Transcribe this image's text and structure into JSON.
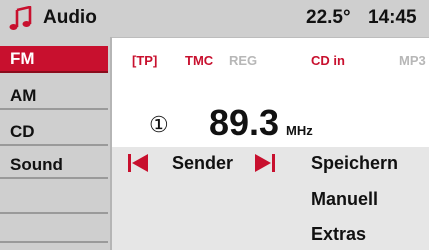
{
  "header": {
    "icon": "music-note-icon",
    "title": "Audio",
    "temperature": "22.5°",
    "time": "14:45"
  },
  "menu": {
    "items": [
      {
        "label": "FM",
        "active": true
      },
      {
        "label": "AM",
        "active": false
      },
      {
        "label": "CD",
        "active": false
      },
      {
        "label": "Sound",
        "active": false
      },
      {
        "label": "",
        "active": false
      },
      {
        "label": "",
        "active": false
      },
      {
        "label": "",
        "active": false
      }
    ]
  },
  "status": {
    "tp": "[TP]",
    "tmc": "TMC",
    "reg": "REG",
    "cd_in": "CD in",
    "mp3": "MP3"
  },
  "tuner": {
    "preset": "①",
    "frequency": "89.3",
    "unit": "MHz"
  },
  "controls": {
    "prev_icon": "skip-back-icon",
    "sender_label": "Sender",
    "next_icon": "skip-forward-icon",
    "speichern_label": "Speichern",
    "manuell_label": "Manuell",
    "extras_label": "Extras"
  },
  "colors": {
    "accent": "#c8102e",
    "menu_bg": "#cfcfcf",
    "inactive_text": "#b7b7b7"
  }
}
